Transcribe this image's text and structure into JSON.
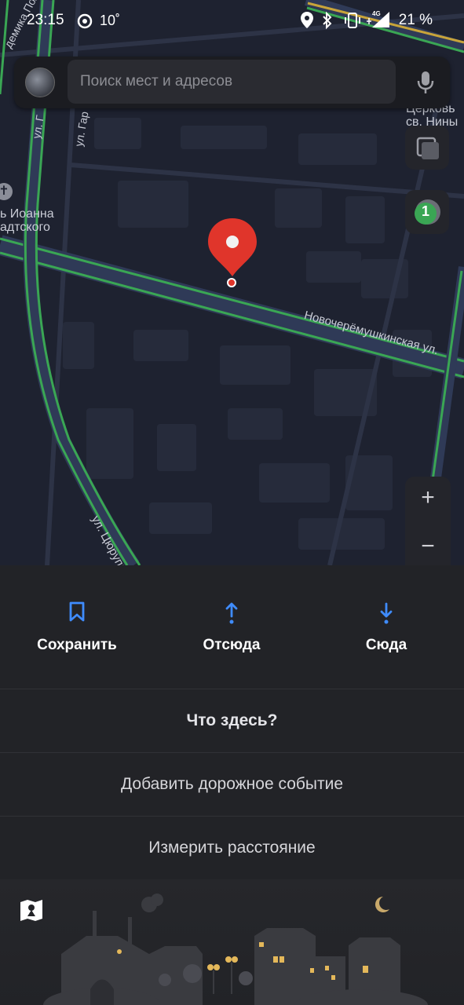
{
  "status_bar": {
    "time": "23:15",
    "temperature": "10˚",
    "network": "4G",
    "battery": "21 %"
  },
  "search": {
    "placeholder": "Поиск мест и адресов"
  },
  "map": {
    "labels": {
      "street_academician": "демика Поляк",
      "street_gar1": "ул. Г",
      "street_gar2": "ул. Гар",
      "church_nina": "Церковь\nсв. Нины",
      "church_ioann": "ь Иоанна\nадтского",
      "street_novocheryomushkinskaya": "Новочерёмушкинская ул.",
      "street_tsyurupy": "ул. Цюрупы"
    },
    "traffic_badge": "1",
    "zoom_in": "+",
    "zoom_out": "−"
  },
  "actions": {
    "save": "Сохранить",
    "from": "Отсюда",
    "to": "Сюда"
  },
  "menu": {
    "whats_here": "Что здесь?",
    "add_road_event": "Добавить дорожное событие",
    "measure_distance": "Измерить расстояние"
  },
  "colors": {
    "accent": "#3f8cff",
    "pin": "#e0352b",
    "traffic_green": "#3aa654"
  }
}
